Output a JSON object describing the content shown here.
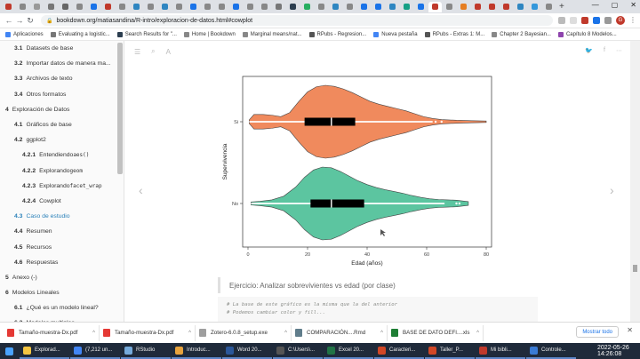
{
  "browser": {
    "tab_colors": [
      "#c0392b",
      "#888",
      "#999",
      "#777",
      "#666",
      "#888",
      "#1a73e8",
      "#c0392b",
      "#888",
      "#2e86c1",
      "#888",
      "#2e86c1",
      "#888",
      "#1a73e8",
      "#888",
      "#888",
      "#1a73e8",
      "#888",
      "#888",
      "#777",
      "#2c3e50",
      "#27ae60",
      "#888",
      "#2e86c1",
      "#888",
      "#1a73e8",
      "#1a73e8",
      "#2e86c1",
      "#16a085",
      "#1a73e8",
      "#c0392b",
      "#888",
      "#e67e22",
      "#c0392b",
      "#c0392b",
      "#c0392b",
      "#2e86c1",
      "#3498db",
      "#888"
    ],
    "url": "bookdown.org/matiasandina/R-intro/exploracion-de-datos.html#cowplot",
    "profile_letter": "G"
  },
  "bookmarks": [
    {
      "label": "Aplicaciones",
      "color": "#4285f4"
    },
    {
      "label": "Evaluating a logistic...",
      "color": "#777"
    },
    {
      "label": "Search Results for \"...",
      "color": "#2c3e50"
    },
    {
      "label": "Home | Bookdown",
      "color": "#888"
    },
    {
      "label": "Marginal means/nat...",
      "color": "#888"
    },
    {
      "label": "RPubs - Regresion...",
      "color": "#555"
    },
    {
      "label": "Nueva pestaña",
      "color": "#4285f4"
    },
    {
      "label": "RPubs - Extras 1: M...",
      "color": "#555"
    },
    {
      "label": "Chapter 2 Bayesian...",
      "color": "#888"
    },
    {
      "label": "Capítulo 8 Modelos...",
      "color": "#8e44ad"
    }
  ],
  "toc": [
    {
      "num": "3.1",
      "label": "Datasets de base",
      "level": 2
    },
    {
      "num": "3.2",
      "label": "Importar datos de manera ma...",
      "level": 2
    },
    {
      "num": "3.3",
      "label": "Archivos de texto",
      "level": 2
    },
    {
      "num": "3.4",
      "label": "Otros formatos",
      "level": 2
    },
    {
      "num": "4",
      "label": "Exploración de Datos",
      "level": 1
    },
    {
      "num": "4.1",
      "label": "Gráficos de base",
      "level": 2
    },
    {
      "num": "4.2",
      "label": "ggplot2",
      "level": 2
    },
    {
      "num": "4.2.1",
      "label": "Entendiendo ",
      "code": "aes()",
      "level": 3
    },
    {
      "num": "4.2.2",
      "label": "Explorando ",
      "code": "geom",
      "level": 3
    },
    {
      "num": "4.2.3",
      "label": "Explorando ",
      "code": "facet_wrap",
      "level": 3
    },
    {
      "num": "4.2.4",
      "label": "Cowplot",
      "level": 3
    },
    {
      "num": "4.3",
      "label": "Caso de estudio",
      "level": 2,
      "active": true
    },
    {
      "num": "4.4",
      "label": "Resumen",
      "level": 2
    },
    {
      "num": "4.5",
      "label": "Recursos",
      "level": 2
    },
    {
      "num": "4.6",
      "label": "Respuestas",
      "level": 2
    },
    {
      "num": "5",
      "label": "Anexo (-)",
      "level": 1
    },
    {
      "num": "6",
      "label": "Modelos Lineales",
      "level": 1
    },
    {
      "num": "6.1",
      "label": "¿Qué es un modelo lineal?",
      "level": 2
    },
    {
      "num": "6.2",
      "label": "Modelos multiples",
      "level": 2
    }
  ],
  "chart_data": {
    "type": "violin",
    "xlabel": "Edad (años)",
    "ylabel": "Supervivencia",
    "xlim": [
      0,
      80
    ],
    "x_ticks": [
      0,
      20,
      40,
      60,
      80
    ],
    "categories": [
      "Si",
      "No"
    ],
    "colors": {
      "Si": "#f08a5d",
      "No": "#5cc5a0"
    },
    "series": [
      {
        "name": "Si",
        "range": [
          0.4,
          80
        ],
        "density": [
          [
            0.4,
            0.05
          ],
          [
            2,
            0.2
          ],
          [
            5,
            0.2
          ],
          [
            8,
            0.18
          ],
          [
            11,
            0.14
          ],
          [
            14,
            0.25
          ],
          [
            17,
            0.55
          ],
          [
            20,
            0.82
          ],
          [
            23,
            0.96
          ],
          [
            26,
            1.0
          ],
          [
            29,
            0.97
          ],
          [
            32,
            0.9
          ],
          [
            35,
            0.8
          ],
          [
            38,
            0.68
          ],
          [
            41,
            0.56
          ],
          [
            44,
            0.48
          ],
          [
            47,
            0.42
          ],
          [
            50,
            0.36
          ],
          [
            53,
            0.3
          ],
          [
            56,
            0.22
          ],
          [
            59,
            0.14
          ],
          [
            62,
            0.09
          ],
          [
            65,
            0.06
          ],
          [
            70,
            0.04
          ],
          [
            75,
            0.03
          ],
          [
            80,
            0.02
          ]
        ],
        "q1": 19,
        "median": 28,
        "q3": 36,
        "whisker": [
          0.4,
          62
        ],
        "outliers": [
          63,
          65
        ]
      },
      {
        "name": "No",
        "range": [
          1,
          74
        ],
        "density": [
          [
            1,
            0.04
          ],
          [
            4,
            0.06
          ],
          [
            8,
            0.1
          ],
          [
            12,
            0.2
          ],
          [
            16,
            0.45
          ],
          [
            19,
            0.72
          ],
          [
            22,
            0.92
          ],
          [
            25,
            1.0
          ],
          [
            28,
            0.98
          ],
          [
            31,
            0.88
          ],
          [
            34,
            0.75
          ],
          [
            37,
            0.62
          ],
          [
            40,
            0.52
          ],
          [
            43,
            0.44
          ],
          [
            46,
            0.38
          ],
          [
            49,
            0.33
          ],
          [
            52,
            0.28
          ],
          [
            55,
            0.22
          ],
          [
            58,
            0.17
          ],
          [
            61,
            0.13
          ],
          [
            64,
            0.11
          ],
          [
            67,
            0.1
          ],
          [
            70,
            0.09
          ],
          [
            74,
            0.05
          ]
        ],
        "q1": 21,
        "median": 28,
        "q3": 39,
        "whisker": [
          1,
          66
        ],
        "outliers": [
          70,
          71
        ]
      }
    ]
  },
  "content": {
    "exercise": "Ejercicio: Analizar sobrevivientes vs edad (por clase)",
    "code_lines": [
      "# La base de este gráfico es la misma que la del anterior",
      "# Podemos cambiar color y fill..."
    ]
  },
  "downloads": [
    {
      "name": "Tamaño-muestra-Dx.pdf",
      "color": "#e53935"
    },
    {
      "name": "Tamaño-muestra-Dx.pdf",
      "color": "#e53935"
    },
    {
      "name": "Zotero-6.0.8_setup.exe",
      "color": "#9e9e9e"
    },
    {
      "name": "COMPARACIÓN....Rmd",
      "color": "#607d8b"
    },
    {
      "name": "BASE DE DATO DEFI....xls",
      "color": "#1e7e34"
    }
  ],
  "downloads_show_all": "Mostrar todo",
  "taskbar": [
    {
      "label": "Explorad...",
      "color": "#f4c542"
    },
    {
      "label": "(7,212 un...",
      "color": "#4285f4"
    },
    {
      "label": "RStudio",
      "color": "#75aadb"
    },
    {
      "label": "Introduc...",
      "color": "#e8a33d"
    },
    {
      "label": "Word 20...",
      "color": "#2b579a"
    },
    {
      "label": "C:\\Users\\...",
      "color": "#555"
    },
    {
      "label": "Excel 20...",
      "color": "#217346"
    },
    {
      "label": "Caracteri...",
      "color": "#d24726"
    },
    {
      "label": "Taller_P...",
      "color": "#d24726"
    },
    {
      "label": "Mi bibli...",
      "color": "#c0392b"
    },
    {
      "label": "Controle...",
      "color": "#3a7bd5"
    }
  ],
  "clock": "2022-05-26 14:26:08"
}
